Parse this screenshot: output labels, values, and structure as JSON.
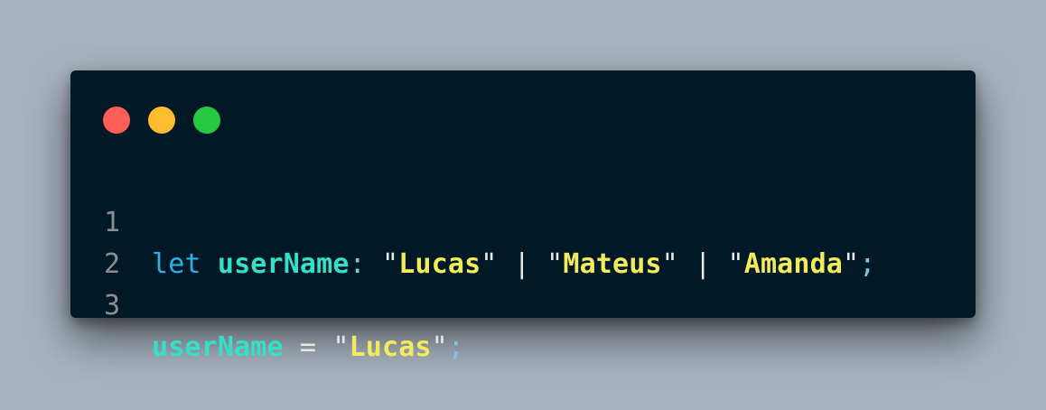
{
  "window_controls": [
    {
      "name": "close",
      "color": "#ff5f57"
    },
    {
      "name": "minimize",
      "color": "#febc2e"
    },
    {
      "name": "maximize",
      "color": "#28c840"
    }
  ],
  "colors": {
    "background": "#a8b3bf",
    "editor_background": "#011826",
    "keyword": "#2cb1e6",
    "identifier": "#34e0c8",
    "string": "#f2ec5b",
    "line_number": "#8a8f94"
  },
  "code_lines": [
    {
      "number": "1",
      "tokens": [
        {
          "text": "let",
          "kind": "keyword"
        },
        {
          "text": " ",
          "kind": "space"
        },
        {
          "text": "userName",
          "kind": "ident"
        },
        {
          "text": ":",
          "kind": "punct"
        },
        {
          "text": " ",
          "kind": "space"
        },
        {
          "text": "\"",
          "kind": "quote"
        },
        {
          "text": "Lucas",
          "kind": "str"
        },
        {
          "text": "\"",
          "kind": "quote"
        },
        {
          "text": " ",
          "kind": "space"
        },
        {
          "text": "|",
          "kind": "op"
        },
        {
          "text": " ",
          "kind": "space"
        },
        {
          "text": "\"",
          "kind": "quote"
        },
        {
          "text": "Mateus",
          "kind": "str"
        },
        {
          "text": "\"",
          "kind": "quote"
        },
        {
          "text": " ",
          "kind": "space"
        },
        {
          "text": "|",
          "kind": "op"
        },
        {
          "text": " ",
          "kind": "space"
        },
        {
          "text": "\"",
          "kind": "quote"
        },
        {
          "text": "Amanda",
          "kind": "str"
        },
        {
          "text": "\"",
          "kind": "quote"
        },
        {
          "text": ";",
          "kind": "punct"
        }
      ]
    },
    {
      "number": "2",
      "tokens": []
    },
    {
      "number": "3",
      "tokens": [
        {
          "text": "userName",
          "kind": "ident"
        },
        {
          "text": " ",
          "kind": "space"
        },
        {
          "text": "=",
          "kind": "op"
        },
        {
          "text": " ",
          "kind": "space"
        },
        {
          "text": "\"",
          "kind": "quote"
        },
        {
          "text": "Lucas",
          "kind": "str"
        },
        {
          "text": "\"",
          "kind": "quote"
        },
        {
          "text": ";",
          "kind": "punct"
        }
      ]
    }
  ]
}
